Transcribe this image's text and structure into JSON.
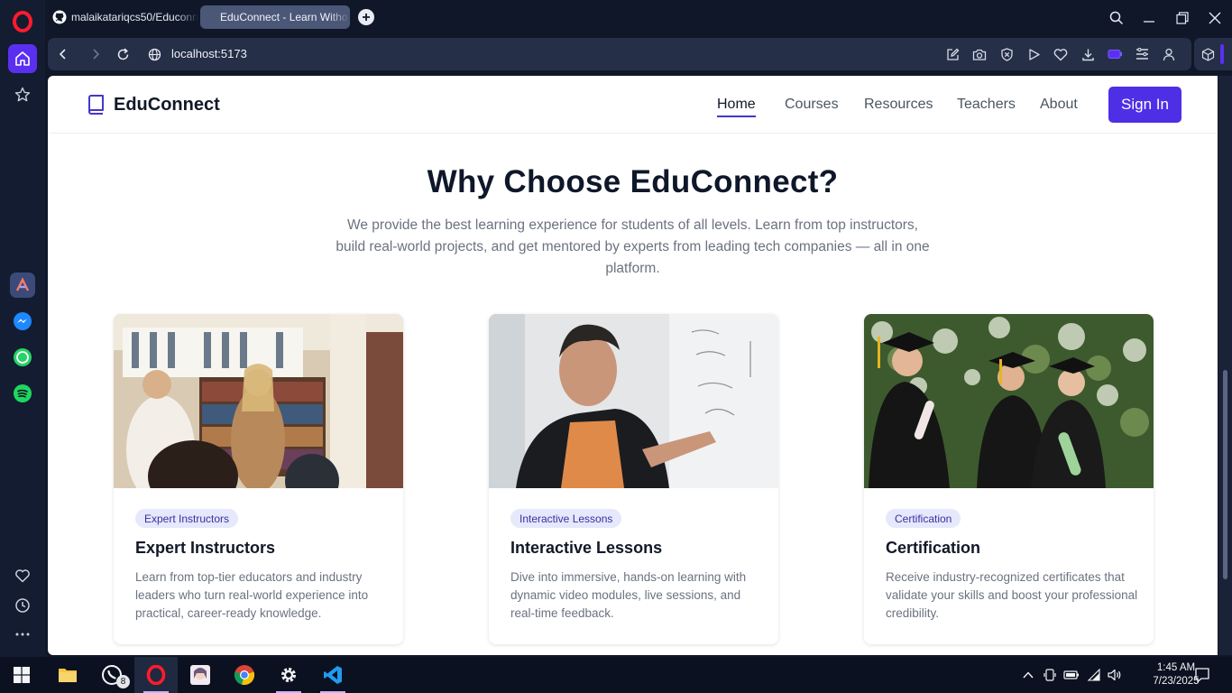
{
  "browser": {
    "tabs": [
      {
        "label": "malaikatariqcs50/Educonn",
        "icon": "github-icon"
      },
      {
        "label": "EduConnect - Learn Witho",
        "icon": "page-icon"
      }
    ],
    "url": "localhost:5173"
  },
  "site": {
    "brand": "EduConnect",
    "nav": [
      {
        "label": "Home",
        "active": true
      },
      {
        "label": "Courses"
      },
      {
        "label": "Resources"
      },
      {
        "label": "Teachers"
      },
      {
        "label": "About"
      }
    ],
    "signin_label": "Sign In"
  },
  "why": {
    "title": "Why Choose EduConnect?",
    "subtitle": "We provide the best learning experience for students of all levels. Learn from top instructors, build real-world projects, and get mentored by experts from leading tech companies — all in one platform."
  },
  "cards": [
    {
      "badge": "Expert Instructors",
      "title": "Expert Instructors",
      "desc": "Learn from top-tier educators and industry leaders who turn real-world experience into practical, career-ready knowledge."
    },
    {
      "badge": "Interactive Lessons",
      "title": "Interactive Lessons",
      "desc": "Dive into immersive, hands-on learning with dynamic video modules, live sessions, and real-time feedback."
    },
    {
      "badge": "Certification",
      "title": "Certification",
      "desc": "Receive industry-recognized certificates that validate your skills and boost your professional credibility."
    }
  ],
  "taskbar": {
    "whatsapp_badge": "8",
    "time": "1:45 AM",
    "date": "7/23/2025"
  },
  "colors": {
    "accent": "#4f2fe6",
    "opera_active": "#5b2ff2"
  }
}
